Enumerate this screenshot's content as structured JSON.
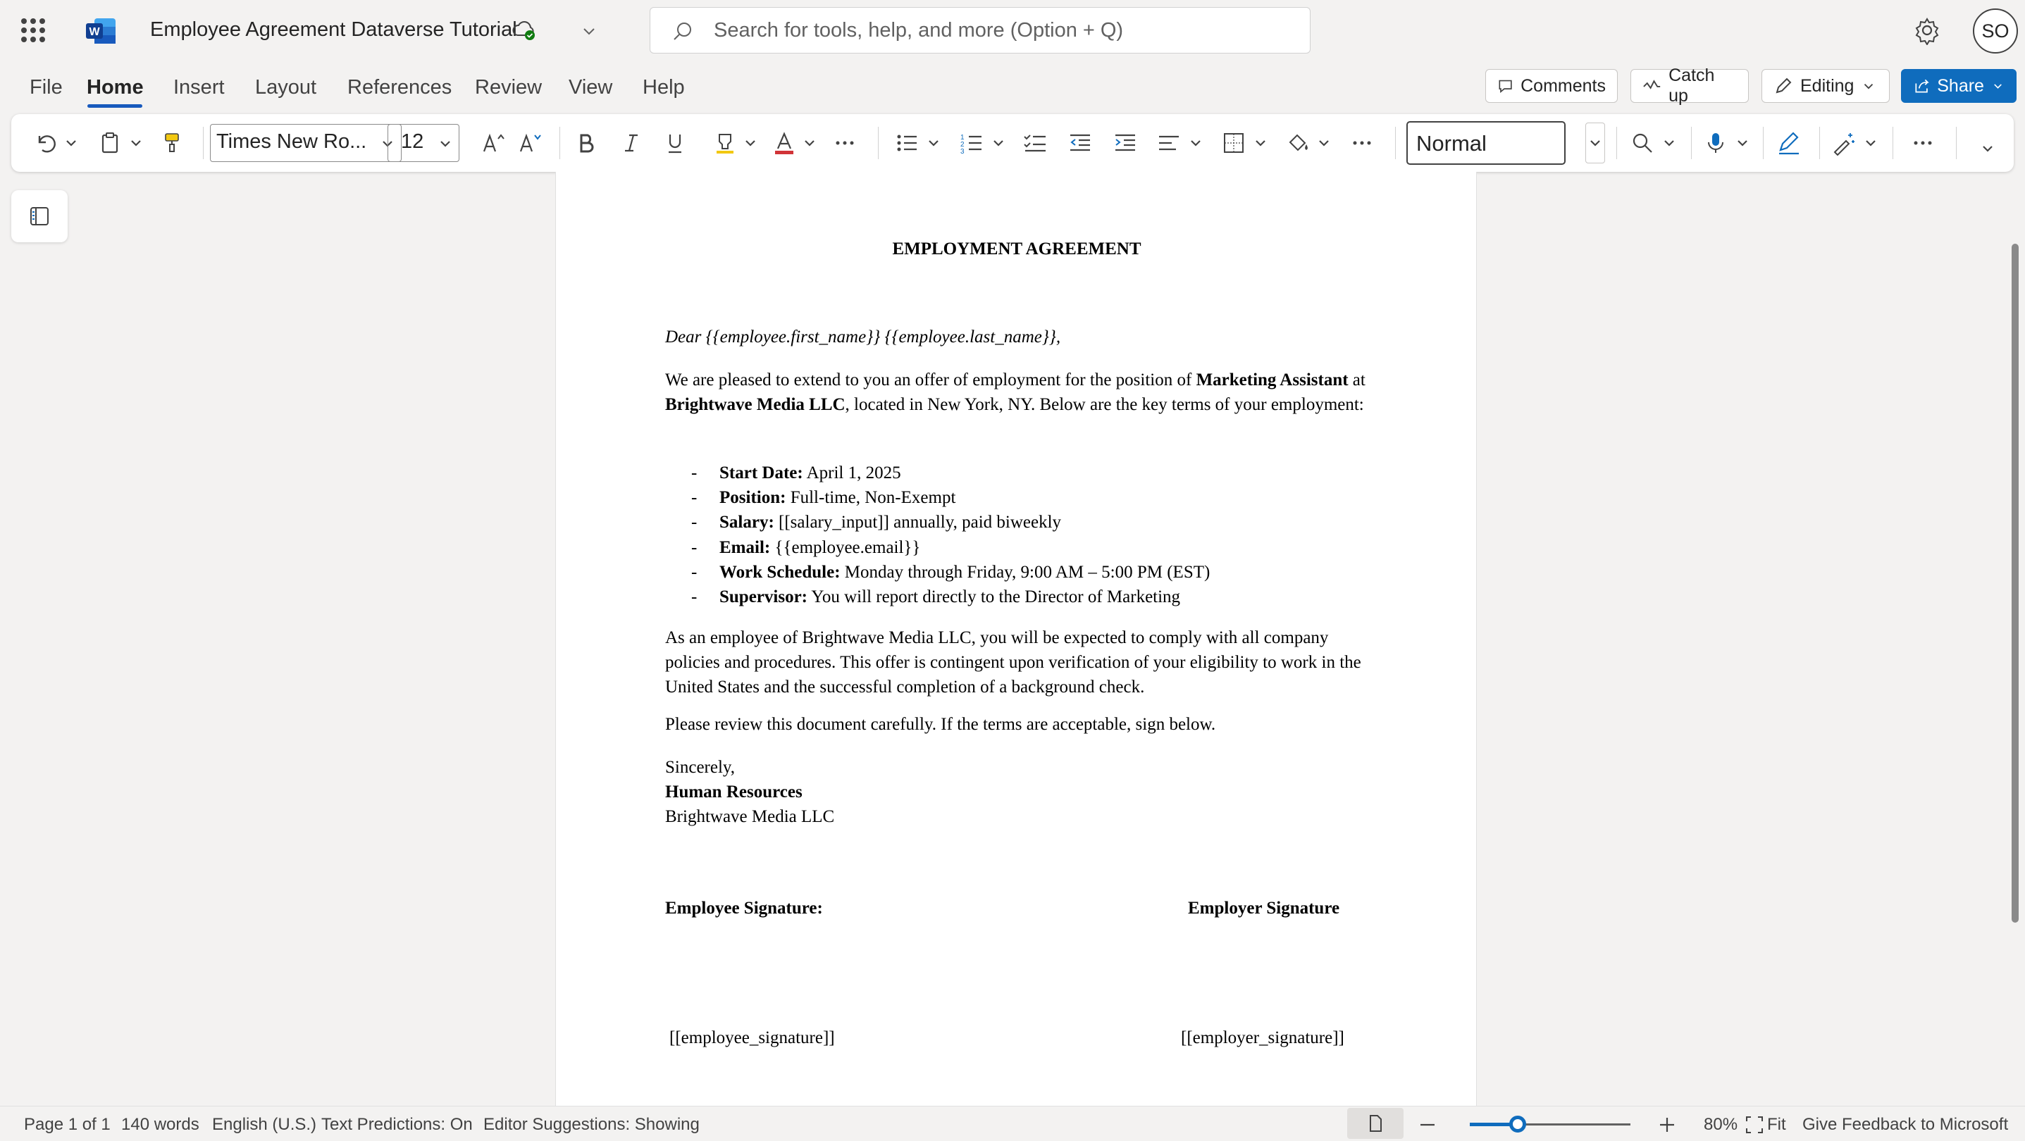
{
  "app": {
    "document_title": "Employee Agreement Dataverse Tutorial",
    "search_placeholder": "Search for tools, help, and more (Option + Q)",
    "user_initials": "SO"
  },
  "menu": {
    "tabs": [
      "File",
      "Home",
      "Insert",
      "Layout",
      "References",
      "Review",
      "View",
      "Help"
    ],
    "active_tab": "Home",
    "comments_label": "Comments",
    "catchup_label": "Catch up",
    "editing_label": "Editing",
    "share_label": "Share"
  },
  "ribbon": {
    "font_name": "Times New Ro...",
    "font_size": "12",
    "style": "Normal"
  },
  "document": {
    "heading": "EMPLOYMENT AGREEMENT",
    "salutation": "Dear {{employee.first_name}} {{employee.last_name}},",
    "intro": {
      "t1": "We are pleased to extend to you an offer of employment for the position of ",
      "b1": "Marketing Assistant",
      "t2": " at ",
      "b2": "Brightwave Media LLC",
      "t3": ", located in New York, NY. Below are the key terms of your employment:"
    },
    "terms": [
      {
        "label": "Start Date:",
        "value": " April 1, 2025"
      },
      {
        "label": "Position:",
        "value": " Full-time, Non-Exempt"
      },
      {
        "label": "Salary:",
        "value": " [[salary_input]] annually, paid biweekly"
      },
      {
        "label": "Email:",
        "value": " {{employee.email}}"
      },
      {
        "label": "Work Schedule:",
        "value": " Monday through Friday, 9:00 AM – 5:00 PM (EST)"
      },
      {
        "label": "Supervisor:",
        "value": " You will report directly to the Director of Marketing"
      }
    ],
    "compliance": "As an employee of Brightwave Media LLC, you will be expected to comply with all company policies and procedures. This offer is contingent upon verification of your eligibility to work in the United States and the successful completion of a background check.",
    "review": "Please review this document carefully. If the terms are acceptable, sign below.",
    "closing": "Sincerely,",
    "signoff_dept": "Human Resources",
    "signoff_company": "Brightwave Media LLC",
    "employee_sig_label": "Employee Signature:",
    "employer_sig_label": "Employer Signature",
    "employee_sig_field": "[[employee_signature]]",
    "employer_sig_field": "[[employer_signature]]"
  },
  "status": {
    "page": "Page 1 of 1",
    "words": "140 words",
    "language": "English (U.S.)",
    "predictions": "Text Predictions: On",
    "editor": "Editor Suggestions: Showing",
    "zoom": "80%",
    "zoom_level": 0.3,
    "fit": "Fit",
    "feedback": "Give Feedback to Microsoft"
  },
  "colors": {
    "accent": "#0f6cbd",
    "word_brand": "#185abd"
  }
}
